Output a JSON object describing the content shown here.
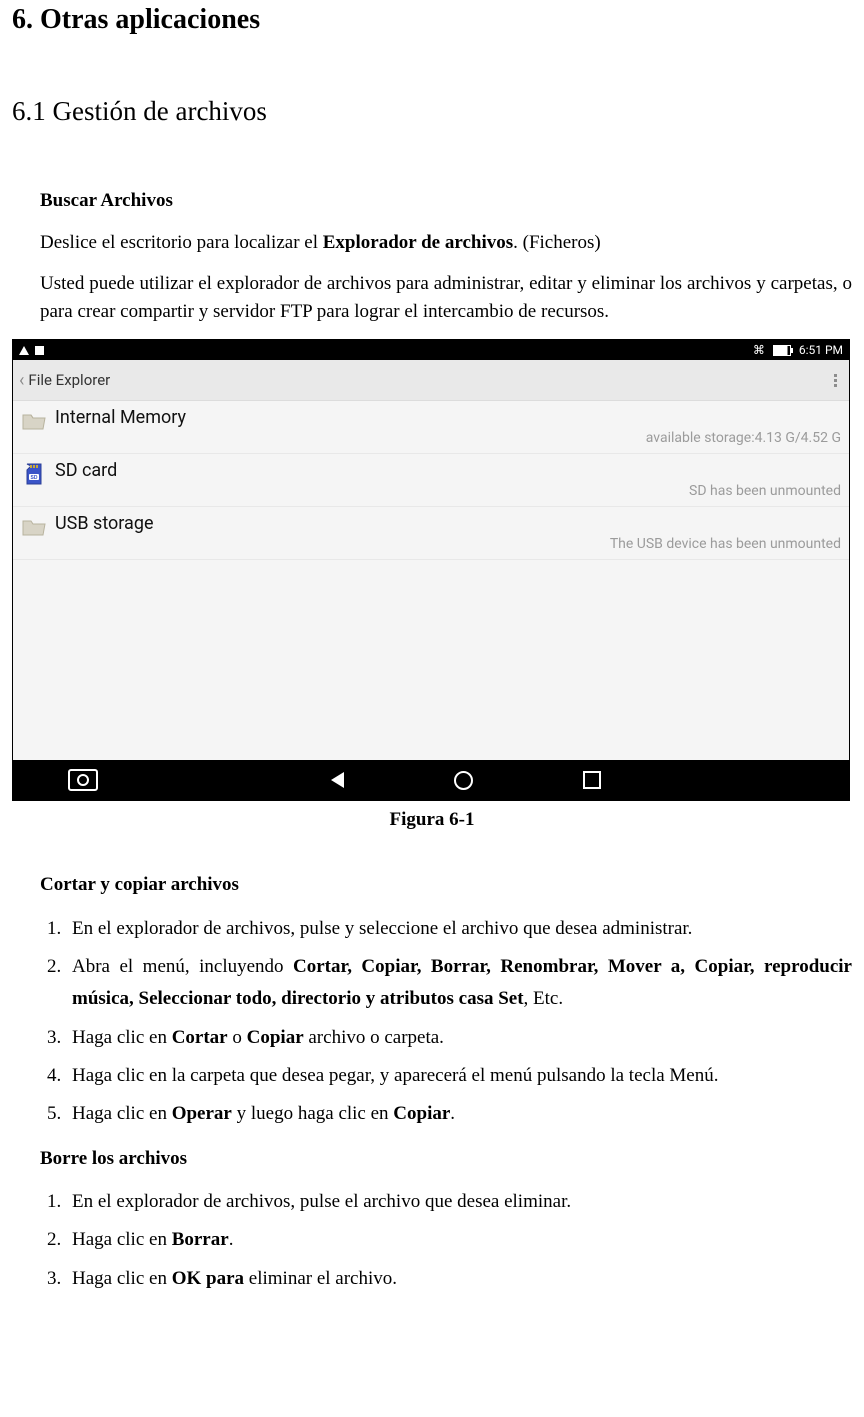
{
  "headings": {
    "h1": "6. Otras aplicaciones",
    "h2": "6.1 Gestión de archivos"
  },
  "intro": {
    "title": "Buscar Archivos",
    "p1_a": "Deslice el escritorio para localizar el ",
    "p1_b": "Explorador de archivos",
    "p1_c": ". (Ficheros)",
    "p2": "Usted puede utilizar el explorador de archivos para administrar, editar y eliminar los archivos y carpetas, o para crear compartir y servidor FTP para lograr el intercambio de recursos."
  },
  "screenshot": {
    "status": {
      "time": "6:51 PM"
    },
    "appbar": {
      "title": "File Explorer"
    },
    "rows": [
      {
        "label": "Internal Memory",
        "sub": "available storage:4.13 G/4.52 G",
        "icon": "folder-icon"
      },
      {
        "label": "SD card",
        "sub": "SD has been unmounted",
        "icon": "sd-icon"
      },
      {
        "label": "USB storage",
        "sub": "The USB device has been unmounted",
        "icon": "folder-icon"
      }
    ]
  },
  "figure_caption": "Figura 6-1",
  "cut_copy": {
    "title": "Cortar y copiar archivos",
    "steps": {
      "s1": "En el explorador de archivos, pulse y seleccione el archivo que desea administrar.",
      "s2_a": "Abra el menú, incluyendo ",
      "s2_b": "Cortar, Copiar, Borrar, Renombrar, Mover a, Copiar, reproducir música, Seleccionar todo, directorio y atributos casa Set",
      "s2_c": ", Etc.",
      "s3_a": "Haga clic en ",
      "s3_b": "Cortar",
      "s3_c": " o ",
      "s3_d": "Copiar",
      "s3_e": " archivo o carpeta.",
      "s4": "Haga clic en la carpeta que desea pegar, y aparecerá el menú pulsando la tecla Menú.",
      "s5_a": "Haga clic en ",
      "s5_b": "Operar",
      "s5_c": " y luego haga clic en ",
      "s5_d": "Copiar",
      "s5_e": "."
    }
  },
  "delete": {
    "title": "Borre los archivos",
    "steps": {
      "s1": "En el explorador de archivos, pulse el archivo que desea eliminar.",
      "s2_a": "Haga clic en ",
      "s2_b": "Borrar",
      "s2_c": ".",
      "s3_a": "Haga clic en ",
      "s3_b": "OK para",
      "s3_c": " eliminar el archivo."
    }
  }
}
